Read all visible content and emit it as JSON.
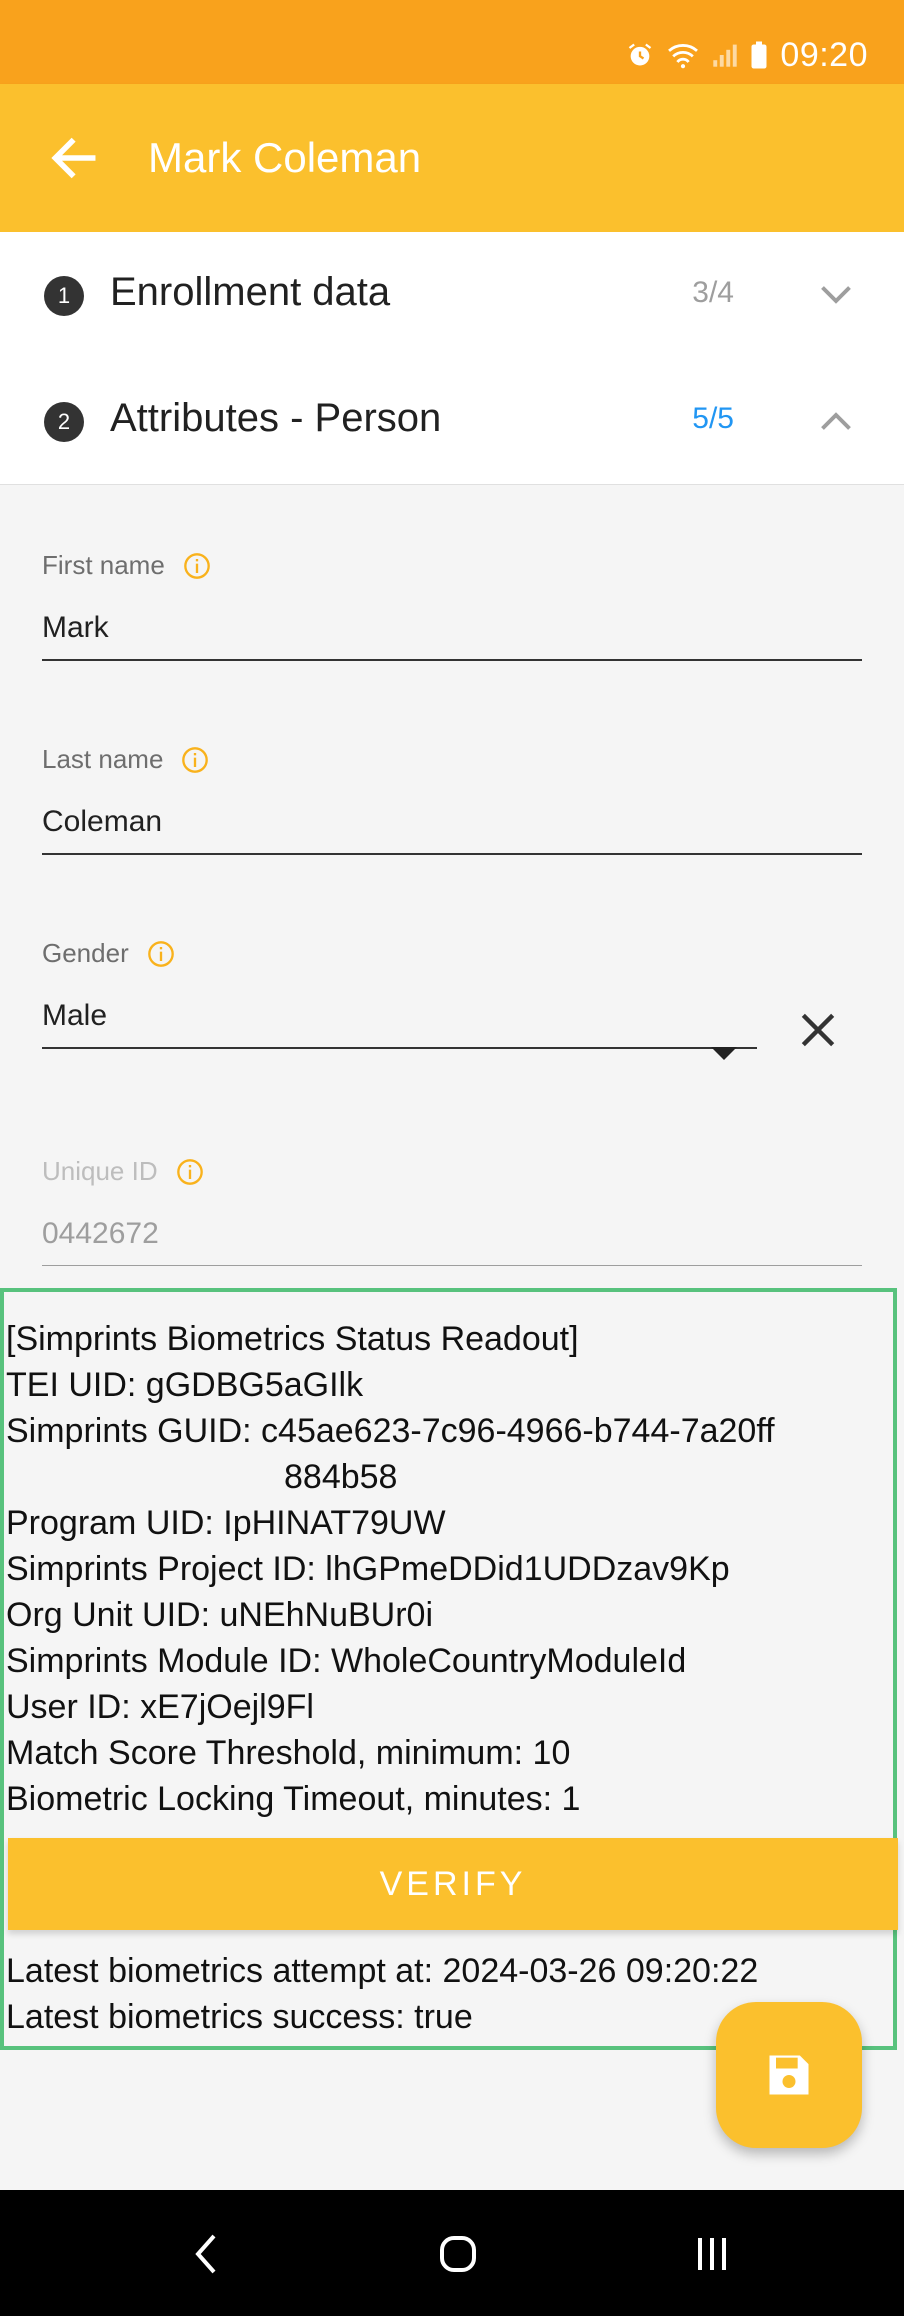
{
  "status_bar": {
    "time": "09:20"
  },
  "app_bar": {
    "title": "Mark Coleman"
  },
  "sections": [
    {
      "number": "1",
      "title": "Enrollment data",
      "count": "3/4"
    },
    {
      "number": "2",
      "title": "Attributes - Person",
      "count": "5/5"
    }
  ],
  "form": {
    "first_name": {
      "label": "First name",
      "value": "Mark"
    },
    "last_name": {
      "label": "Last name",
      "value": "Coleman"
    },
    "gender": {
      "label": "Gender",
      "value": "Male"
    },
    "unique_id": {
      "label": "Unique ID",
      "value": "0442672"
    }
  },
  "biometrics": {
    "header": "[Simprints Biometrics Status Readout]",
    "tei_uid": "TEI UID: gGDBG5aGIlk",
    "guid_line1": "Simprints GUID: c45ae623-7c96-4966-b744-7a20ff",
    "guid_line2": "884b58",
    "program_uid": "Program UID: IpHINAT79UW",
    "project_id": "Simprints Project ID: lhGPmeDDid1UDDzav9Kp",
    "org_unit": "Org Unit UID: uNEhNuBUr0i",
    "module_id": "Simprints Module ID: WholeCountryModuleId",
    "user_id": "User ID: xE7jOejl9Fl",
    "match_threshold": "Match Score Threshold, minimum:  10",
    "locking_timeout": "Biometric Locking Timeout, minutes:  1",
    "verify_label": "VERIFY",
    "latest_attempt": "Latest biometrics attempt at: 2024-03-26 09:20:22",
    "latest_success": "Latest biometrics success: true"
  },
  "colors": {
    "status_bar": "#f9a21c",
    "app_bar": "#fbc02d",
    "accent_blue": "#2196f3",
    "panel_border": "#58c27d"
  },
  "icons": [
    "alarm-icon",
    "wifi-icon",
    "signal-icon",
    "battery-icon",
    "back-arrow-icon",
    "chevron-down-icon",
    "chevron-up-icon",
    "info-icon",
    "dropdown-arrow-icon",
    "close-icon",
    "save-icon",
    "nav-back-icon",
    "nav-home-icon",
    "nav-recents-icon"
  ]
}
